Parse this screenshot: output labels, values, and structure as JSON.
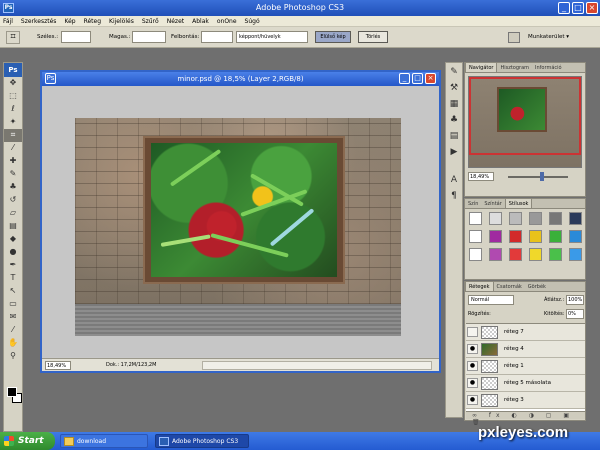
{
  "app": {
    "logo": "Ps",
    "title": "Adobe Photoshop CS3"
  },
  "menu": [
    "Fájl",
    "Szerkesztés",
    "Kép",
    "Réteg",
    "Kijelölés",
    "Szűrő",
    "Nézet",
    "Ablak",
    "onOne",
    "Súgó"
  ],
  "options": {
    "width_label": "Széles.:",
    "height_label": "Magas.:",
    "resolution_label": "Felbontás:",
    "unit_select": "képpont/hüvelyk",
    "front_image_button": "Elülső kép",
    "clear_button": "Törlés",
    "workspace_label": "Munkaterület ▾"
  },
  "document": {
    "title": "minor.psd @ 18,5% (Layer 2,RGB/8)",
    "zoom": "18,49%",
    "info": "Dok.: 17,2M/123,2M"
  },
  "navigator": {
    "tabs": [
      "Navigátor",
      "Hisztogram",
      "Információ"
    ],
    "zoom": "18,49%"
  },
  "swatches": {
    "tabs": [
      "Szín",
      "Színtár",
      "Stílusok"
    ]
  },
  "layers": {
    "tabs": [
      "Rétegek",
      "Csatornák",
      "Görbék"
    ],
    "blend_mode": "Normál",
    "opacity_label": "Átlátsz.:",
    "opacity": "100%",
    "lock_label": "Rögzítés:",
    "fill_label": "Kitöltés:",
    "fill": "0%",
    "items": [
      {
        "name": "réteg 7",
        "visible": false
      },
      {
        "name": "réteg 4",
        "visible": true
      },
      {
        "name": "réteg 1",
        "visible": true
      },
      {
        "name": "réteg 5 másolata",
        "visible": true
      },
      {
        "name": "réteg 3",
        "visible": true
      }
    ]
  },
  "taskbar": {
    "start": "Start",
    "tasks": [
      "download",
      "Adobe Photoshop CS3"
    ]
  },
  "watermark": "pxleyes.com",
  "colors": {
    "titlebar": "#245bd1",
    "close": "#d8472e",
    "start": "#3fa63c"
  }
}
